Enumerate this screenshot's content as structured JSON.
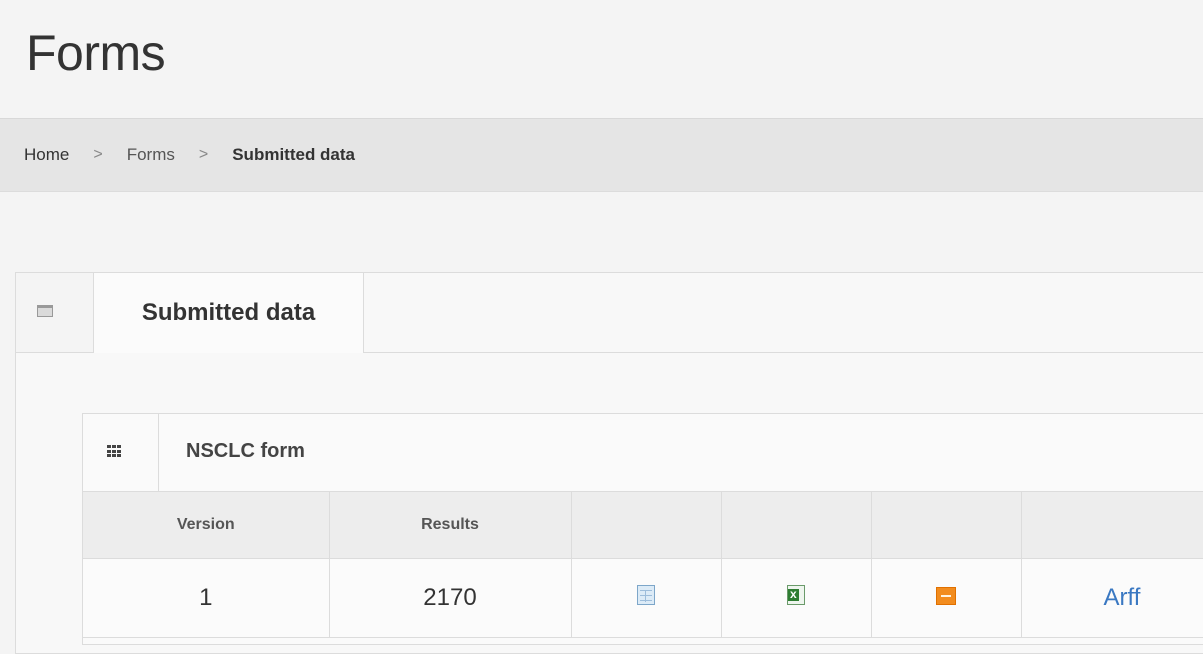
{
  "page": {
    "title": "Forms"
  },
  "breadcrumb": {
    "items": [
      {
        "label": "Home"
      },
      {
        "label": "Forms"
      },
      {
        "label": "Submitted data"
      }
    ],
    "separator": ">"
  },
  "panel": {
    "tab_label": "Submitted data",
    "tab_icon": "window-icon"
  },
  "form": {
    "name": "NSCLC form",
    "icon": "grid-icon",
    "columns": [
      "Version",
      "Results",
      "",
      "",
      "",
      ""
    ],
    "rows": [
      {
        "version": "1",
        "results": "2170",
        "icons": [
          "table-view-icon",
          "excel-export-icon",
          "xml-export-icon"
        ],
        "arff_label": "Arff"
      }
    ]
  },
  "colors": {
    "link": "#3a78c2",
    "xml_icon": "#f28c1e",
    "excel_icon": "#2e7d32"
  }
}
